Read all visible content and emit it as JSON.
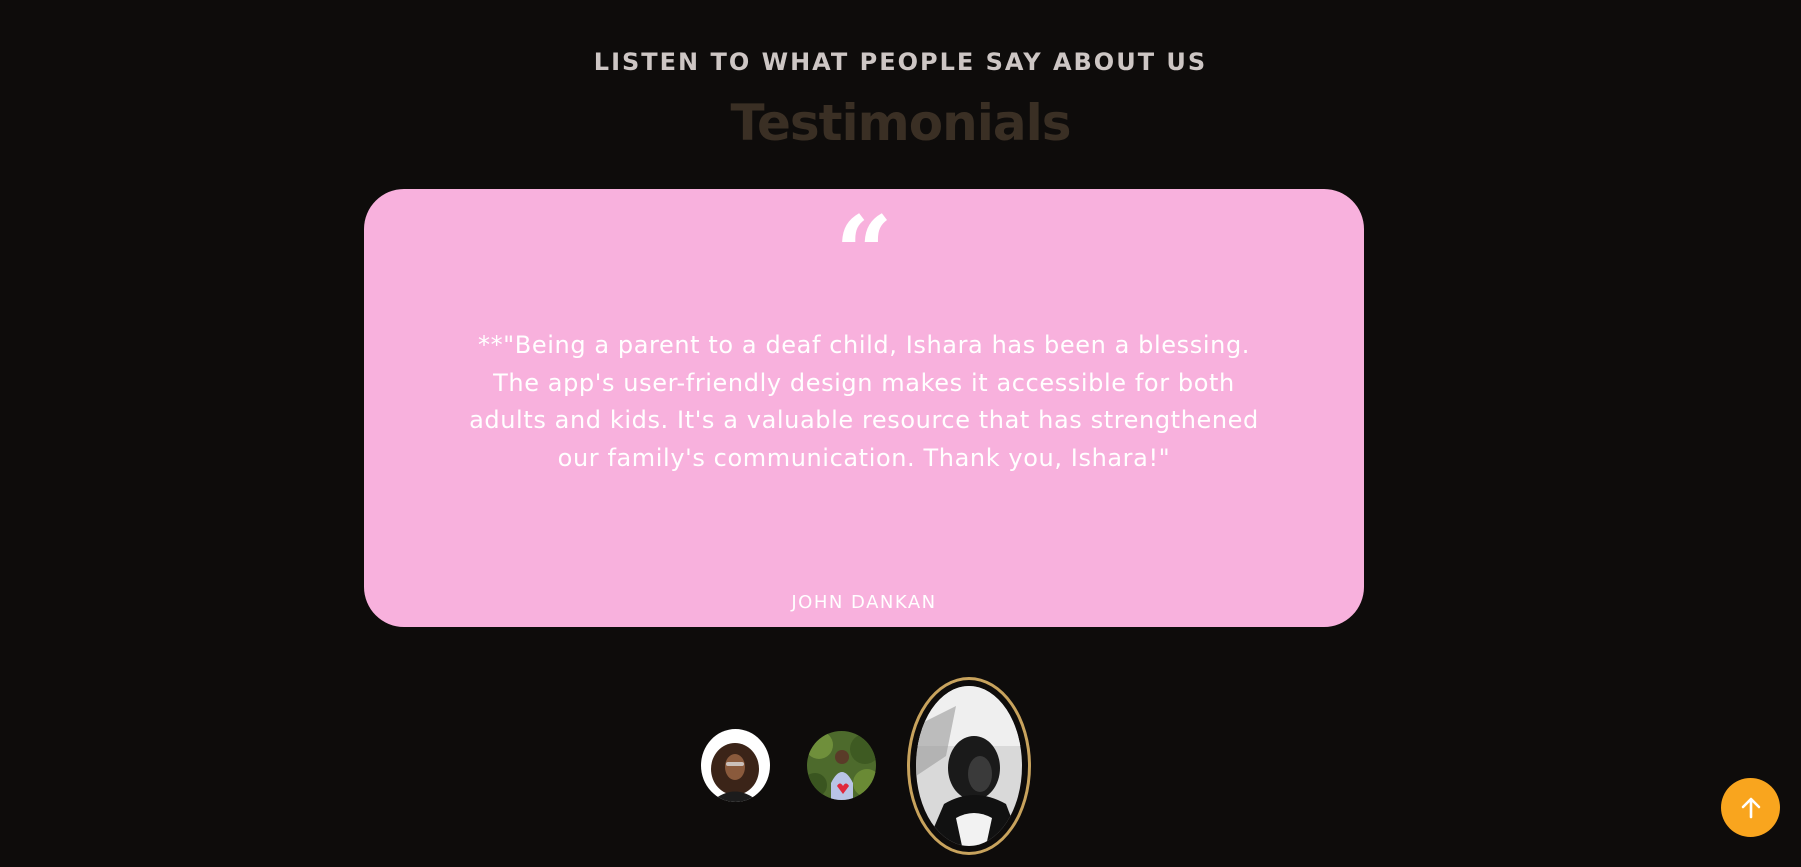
{
  "section": {
    "eyebrow": "LISTEN TO WHAT PEOPLE SAY ABOUT US",
    "title": "Testimonials"
  },
  "testimonial": {
    "quote_icon": "quote-icon",
    "text": "**\"Being a parent to a deaf child, Ishara has been a blessing. The app's user-friendly design makes it accessible for both adults and kids. It's a valuable resource that has strengthened our family's communication. Thank you, Ishara!\"",
    "author": "JOHN DANKAN"
  },
  "avatars": [
    {
      "name": "avatar-woman-curly-hair",
      "active": false
    },
    {
      "name": "avatar-person-with-heart",
      "active": false
    },
    {
      "name": "avatar-man-looking-up",
      "active": true
    }
  ],
  "scroll_top": {
    "icon": "arrow-up-icon"
  },
  "colors": {
    "background": "#0e0c0b",
    "card": "#f8b1dd",
    "eyebrow": "#cdc6c4",
    "title": "#3a2f24",
    "active_border": "#c8a35d",
    "scroll_button": "#f9a51e"
  }
}
